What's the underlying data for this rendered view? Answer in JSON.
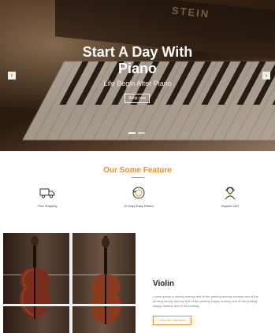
{
  "hero": {
    "brand": "STEIN",
    "title_line1": "Start A Day With",
    "title_line2": "Piano",
    "subtitle": "Life Begin After Piano",
    "button": "Shop now",
    "prev_arrow": "‹",
    "next_arrow": "›",
    "slides": [
      true,
      false
    ]
  },
  "features": {
    "title": "Our Some Feature",
    "items": [
      {
        "icon": "truck-icon",
        "label": "Free Shipping"
      },
      {
        "icon": "return-icon",
        "label": "15 Days Easy Return"
      },
      {
        "icon": "support-icon",
        "label": "Support 24/7"
      }
    ]
  },
  "product": {
    "name": "Violin",
    "description": "Lorem ipsum is simply dummy text of the printing dummy dummy text of the printing simply dummy text of the printing simply dummy text of the printing simply dummy text of the printing.",
    "button": "View All Collection"
  },
  "colors": {
    "accent": "#e8902e"
  }
}
